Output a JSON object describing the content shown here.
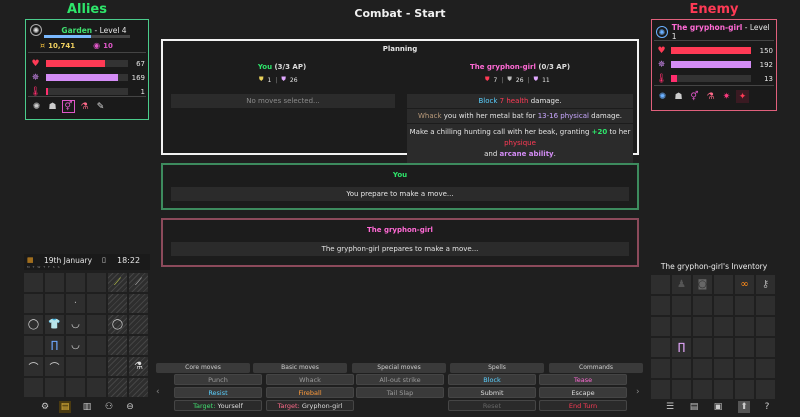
{
  "allies": {
    "heading": "Allies",
    "name": "Garden",
    "level_text": " - Level 4",
    "money": "10,741",
    "essence": "10",
    "health": "67",
    "mana": "169",
    "lust": "1",
    "health_fill": 0.72,
    "mana_fill": 0.88,
    "lust_fill": 0.02,
    "name_color": "#40e070"
  },
  "enemy": {
    "heading": "Enemy",
    "name": "The gryphon-girl",
    "level_text": " - Level 1",
    "health": "150",
    "mana": "192",
    "lust": "13",
    "health_fill": 1.0,
    "mana_fill": 1.0,
    "lust_fill": 0.08,
    "name_color": "#ff6ad5"
  },
  "title": "Combat - Start",
  "planning": {
    "heading": "Planning",
    "you_label": "You",
    "you_ap": " (3/3 AP)",
    "you_ap_num": "3",
    "you_stat1": "1",
    "you_stat2": "26",
    "enemy_label": "The gryphon-girl",
    "enemy_ap": "(0/3 AP)",
    "enemy_stat1": "7",
    "enemy_stat2": "26",
    "enemy_stat3": "11",
    "no_moves": "No moves selected...",
    "move1_a": "Block ",
    "move1_b": "7 health",
    "move1_c": " damage.",
    "move2_a": "Whack",
    "move2_b": " you with her metal bat for ",
    "move2_c": "13-16 physical",
    "move2_d": " damage.",
    "move3_a": "Make a chilling hunting call with her beak, granting ",
    "move3_b": "+20",
    "move3_c": " to her ",
    "move3_d": "physique",
    "move3_e": "and ",
    "move3_f": "arcane ability",
    "move3_g": "."
  },
  "you_panel": {
    "heading": "You",
    "text": "You prepare to make a move..."
  },
  "gg_panel": {
    "heading": "The gryphon-girl",
    "text": "The gryphon-girl prepares to make a move..."
  },
  "date": {
    "day": "19th January",
    "time": "18:22",
    "weekday_marks": "M T W T F S S"
  },
  "inventory_title": "The gryphon-girl's Inventory",
  "moves": {
    "tabs": [
      "Core moves",
      "Basic moves",
      "Special moves",
      "Spells",
      "Commands"
    ],
    "col1": [
      "Punch",
      "Resist"
    ],
    "col2": [
      "Whack",
      "Fireball"
    ],
    "col3": [
      "All-out strike",
      "Tail Slap"
    ],
    "col4": [
      "Block",
      "Submit",
      "Reset"
    ],
    "col5": [
      "Tease",
      "Escape",
      "End Turn"
    ],
    "target_you_label": "Target:",
    "target_you_value": " Yourself",
    "target_enemy_label": "Target:",
    "target_enemy_value": " Gryphon-girl",
    "left_arrow": "‹",
    "right_arrow": "›"
  },
  "colors": {
    "health": "#ff3a55",
    "mana": "#d38cf5",
    "lust": "#ff2e6e",
    "green": "#2ee66b",
    "pink": "#ff6ad5"
  }
}
